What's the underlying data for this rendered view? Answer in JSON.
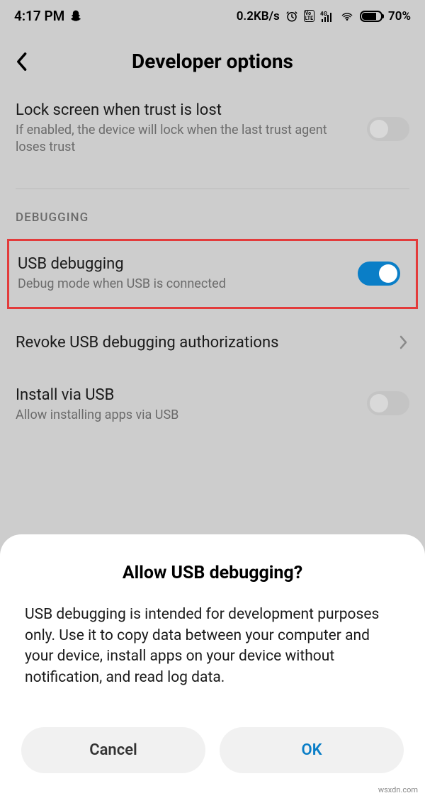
{
  "status": {
    "time": "4:17 PM",
    "data_rate": "0.2KB/s",
    "battery_pct": "70%"
  },
  "header": {
    "title": "Developer options"
  },
  "settings": {
    "lock_trust": {
      "title": "Lock screen when trust is lost",
      "subtitle": "If enabled, the device will lock when the last trust agent loses trust"
    },
    "section_debug": "DEBUGGING",
    "usb_debugging": {
      "title": "USB debugging",
      "subtitle": "Debug mode when USB is connected"
    },
    "revoke": {
      "title": "Revoke USB debugging authorizations"
    },
    "install_usb": {
      "title": "Install via USB",
      "subtitle": "Allow installing apps via USB"
    }
  },
  "dialog": {
    "title": "Allow USB debugging?",
    "body": "USB debugging is intended for development purposes only. Use it to copy data between your computer and your device, install apps on your device without notification, and read log data.",
    "cancel": "Cancel",
    "ok": "OK"
  },
  "watermark": "wsxdn.com"
}
